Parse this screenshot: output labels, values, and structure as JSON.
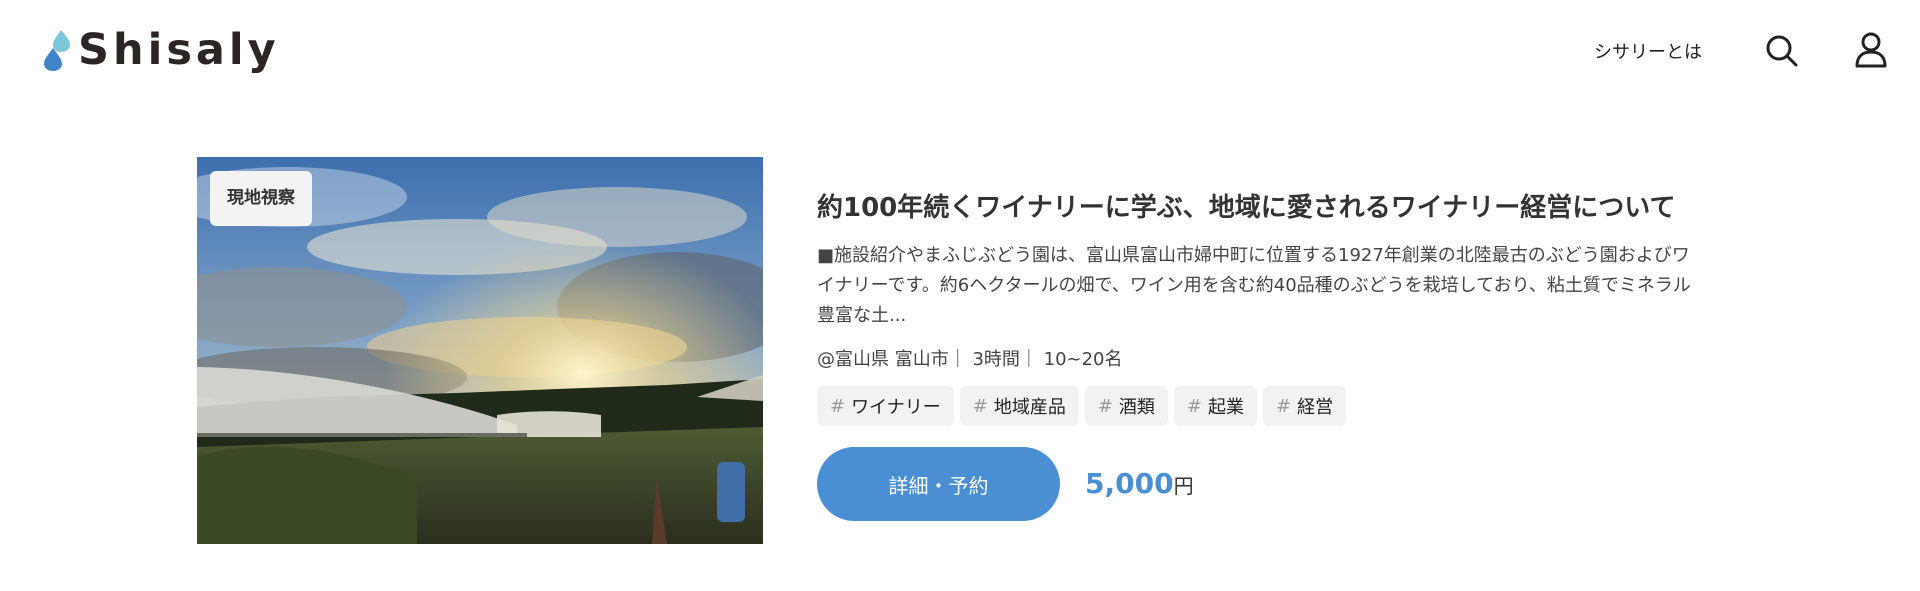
{
  "header": {
    "logo_text": "Shisaly",
    "nav_about": "シサリーとは"
  },
  "colors": {
    "accent": "#4a8fd4",
    "logo_drop_light": "#7cc7d9",
    "logo_drop_dark": "#3f86c8",
    "text": "#333333"
  },
  "icons": {
    "search": "search-icon",
    "user": "user-icon",
    "logo": "logo-mark-icon"
  },
  "listing": {
    "badge": "現地視察",
    "title": "約100年続くワイナリーに学ぶ、地域に愛されるワイナリー経営について",
    "description": "■施設紹介やまふじぶどう園は、富山県富山市婦中町に位置する1927年創業の北陸最古のぶどう園およびワイナリーです。約6ヘクタールの畑で、ワイン用を含む約40品種のぶどうを栽培しており、粘土質でミネラル豊富な土...",
    "meta": "@富山県 富山市｜ 3時間｜ 10~20名",
    "tags": [
      "ワイナリー",
      "地域産品",
      "酒類",
      "起業",
      "経営"
    ],
    "tag_prefix": "#",
    "cta_label": "詳細・予約",
    "price": "5,000",
    "price_unit": "円"
  }
}
